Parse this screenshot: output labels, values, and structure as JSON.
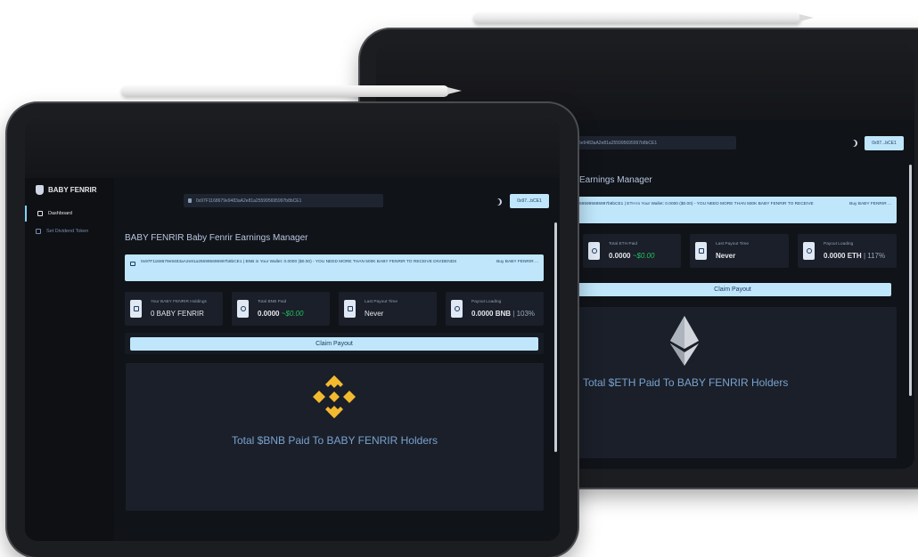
{
  "brand": {
    "name": "BABY FENRIR"
  },
  "sidebar": {
    "items": [
      {
        "label": "Dashboard"
      },
      {
        "label": "Set Dividend Token"
      }
    ]
  },
  "header": {
    "address": "0x97F1168679e9483aA2e81a255995695997b8bCE1",
    "wallet_button": "0x97...bCE1"
  },
  "front": {
    "title": "BABY FENRIR Baby Fenrir Earnings Manager",
    "notice": "0x97F1168679e9483aA2e81a255995695997b8bCE1 | BNB in Your Wallet: 0.0000 ($0.00) - YOU NEED MORE THAN 500K BABY FENRIR TO RECEIVE DIVIDENDS",
    "buy_link": "Buy BABY FENRIR ...",
    "cards": [
      {
        "label": "Your BABY FENRIR Holdings",
        "value": "0 BABY FENRIR",
        "usd": "",
        "pct": ""
      },
      {
        "label": "Total BNB Paid",
        "value": "0.0000",
        "usd": "~$0.00",
        "pct": ""
      },
      {
        "label": "Last Payout Time",
        "value": "Never",
        "usd": "",
        "pct": ""
      },
      {
        "label": "Payout Loading",
        "value": "0.0000 BNB",
        "usd": "",
        "pct": "| 103%"
      }
    ],
    "claim": "Claim Payout",
    "total_text": "Total $BNB Paid To BABY FENRIR Holders",
    "coin_color": "#F3BA2F"
  },
  "back": {
    "address_fragment": "5e9483aA2e81a255995695997b8bCE1",
    "title": "Earnings Manager",
    "notice": "695995695997b8bCE1 | ETH In Your Wallet: 0.0000 ($0.00) - YOU NEED MORE THAN 500K BABY FENRIR TO RECEIVE",
    "buy_link": "Buy BABY FENRIR ...",
    "cards": [
      {
        "label": "Total ETH Paid",
        "value": "0.0000",
        "usd": "~$0.00",
        "pct": ""
      },
      {
        "label": "Last Payout Time",
        "value": "Never",
        "usd": "",
        "pct": ""
      },
      {
        "label": "Payout Loading",
        "value": "0.0000 ETH",
        "usd": "",
        "pct": "| 117%"
      }
    ],
    "claim": "Claim Payout",
    "total_text": "Total $ETH Paid To BABY FENRIR Holders"
  }
}
